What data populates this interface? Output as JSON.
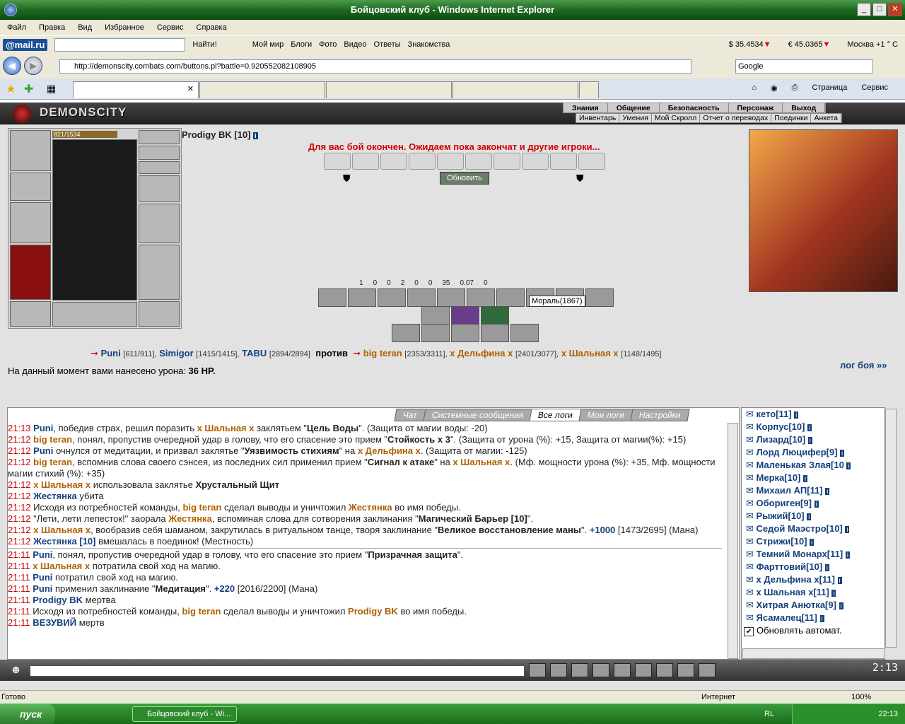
{
  "window": {
    "title": "Бойцовский клуб - Windows Internet Explorer"
  },
  "menu": [
    "Файл",
    "Правка",
    "Вид",
    "Избранное",
    "Сервис",
    "Справка"
  ],
  "mailbar": {
    "logo": "@mail.ru",
    "find": "Найти!",
    "links": [
      "Мой мир",
      "Блоги",
      "Фото",
      "Видео",
      "Ответы",
      "Знакомства"
    ],
    "usd": "$ 35.4534",
    "eur": "€ 45.0365",
    "weather": "Москва +1 ° С"
  },
  "address": {
    "url": "http://demonscity.combats.com/buttons.pl?battle=0.920552082108905",
    "search": "Google"
  },
  "ie_tools": {
    "page": "Страница",
    "service": "Сервис"
  },
  "game": {
    "logo": "DEMONSCITY",
    "menu1": [
      "Знания",
      "Общение",
      "Безопасность",
      "Персонаж",
      "Выход"
    ],
    "menu2": [
      "Инвентарь",
      "Умения",
      "Мой Скролл",
      "Отчет о переводах",
      "Поединки",
      "Анкета"
    ]
  },
  "char": {
    "hp": "821/1534",
    "name": "Prodigy BK [10]"
  },
  "battle": {
    "end_msg": "Для вас бой окончен. Ожидаем пока закончат и другие игроки...",
    "refresh": "Обновить",
    "stats": [
      "1",
      "0",
      "0",
      "2",
      "0",
      "0",
      "35",
      "0.07",
      "0"
    ],
    "tooltip": "Мораль(1867)",
    "vs": "против",
    "damage_label": "На данный момент вами нанесено урона:",
    "damage": "36 HP.",
    "log_link": "лог боя »»"
  },
  "teams": {
    "left": [
      {
        "n": "Puni",
        "hp": "[611/911],"
      },
      {
        "n": "Simigor",
        "hp": "[1415/1415],"
      },
      {
        "n": "TABU",
        "hp": "[2894/2894]"
      }
    ],
    "right": [
      {
        "n": "big teran",
        "hp": "[2353/3311],"
      },
      {
        "n": "x Дельфина x",
        "hp": "[2401/3077],"
      },
      {
        "n": "x Шальная x",
        "hp": "[1148/1495]"
      }
    ]
  },
  "chat_tabs": [
    "Чат",
    "Системные сообщения",
    "Все логи",
    "Мои логи",
    "Настройки"
  ],
  "log": [
    {
      "t": "21:13",
      "html": "<span class='b'>Puni</span>, победив страх, решил поразить <span class='o'>x Шальная x</span> заклятьем \"<b>Цель Воды</b>\". (Защита от магии воды: -20)"
    },
    {
      "t": "21:12",
      "html": "<span class='o'>big teran</span>, понял, пропустив очередной удар в голову, что его спасение это прием \"<b>Стойкость x 3</b>\". (Защита от урона (%): +15, Защита от магии(%): +15)"
    },
    {
      "t": "21:12",
      "html": "<span class='b'>Puni</span> очнулся от медитации, и призвал заклятье \"<b>Уязвимость стихиям</b>\" на <span class='o'>x Дельфина x</span>. (Защита от магии: -125)"
    },
    {
      "t": "21:12",
      "html": "<span class='o'>big teran</span>, вспомнив слова своего сэнсея, из последних сил применил прием \"<b>Сигнал к атаке</b>\" на <span class='o'>x Шальная x</span>. (Мф. мощности урона (%): +35, Мф. мощности магии стихий (%): +35)"
    },
    {
      "t": "21:12",
      "html": "<span class='o'>x Шальная x</span> использовала заклятье <b>Хрустальный Щит</b>"
    },
    {
      "t": "21:12",
      "html": "<span class='b'>Жестянка</span> убита"
    },
    {
      "t": "21:12",
      "html": "Исходя из потребностей команды, <span class='o'>big teran</span> сделал выводы и уничтожил <span class='o'>Жестянка</span> во имя победы."
    },
    {
      "t": "21:12",
      "html": "\"Лети, лети лепесток!\" заорала <span class='o'>Жестянка</span>, вспоминая слова для сотворения заклинания \"<b>Магический Барьер [10]</b>\"."
    },
    {
      "t": "21:12",
      "html": "<span class='o'>x Шальная x</span>, вообразив себя шаманом, закрутилась в ритуальном танце, творя заклинание \"<b>Великое восстановление маны</b>\". <span class='b'>+1000</span> [1473/2695] (Мана)"
    },
    {
      "t": "21:12",
      "html": "<span class='b'>Жестянка [10]</span> вмешалась в поединок! (Местность)"
    },
    {
      "sep": true
    },
    {
      "t": "21:11",
      "html": "<span class='b'>Puni</span>, понял, пропустив очередной удар в голову, что его спасение это прием \"<b>Призрачная защита</b>\"."
    },
    {
      "t": "21:11",
      "html": "<span class='o'>x Шальная x</span> потратила свой ход на магию."
    },
    {
      "t": "21:11",
      "html": "<span class='b'>Puni</span> потратил свой ход на магию."
    },
    {
      "t": "21:11",
      "html": "<span class='b'>Puni</span> применил заклинание \"<b>Медитация</b>\". <span class='b'>+220</span> [2016/2200] (Мана)"
    },
    {
      "t": "21:11",
      "html": "<span class='b'>Prodigy BK</span> мертва"
    },
    {
      "t": "21:11",
      "html": "Исходя из потребностей команды, <span class='o'>big teran</span> сделал выводы и уничтожил <span class='o'>Prodigy BK</span> во имя победы."
    },
    {
      "t": "21:11",
      "html": "<span class='b'>ВЕЗУВИЙ</span> мертв"
    }
  ],
  "players": [
    "кето[11]",
    "Корпус[10]",
    "Лизард[10]",
    "Лорд Люцифер[9]",
    "Маленькая Злая[10",
    "Мерка[10]",
    "Михаил АП[11]",
    "Обориген[9]",
    "Рыжий[10]",
    "Седой Маэстро[10]",
    "Стрижи[10]",
    "Темний Монарх[11]",
    "Фарттовий[10]",
    "x Дельфина x[11]",
    "x Шальная x[11]",
    "Хитрая Анютка[9]",
    "Ясамалец[11]"
  ],
  "auto_refresh": "Обновлять автомат.",
  "clock": "2:13",
  "status": {
    "left": "Готово",
    "zone": "Интернет",
    "zoom": "100%"
  },
  "taskbar": {
    "start": "пуск",
    "item": "Бойцовский клуб - Wi...",
    "lang": "RL",
    "time": "22:13"
  }
}
